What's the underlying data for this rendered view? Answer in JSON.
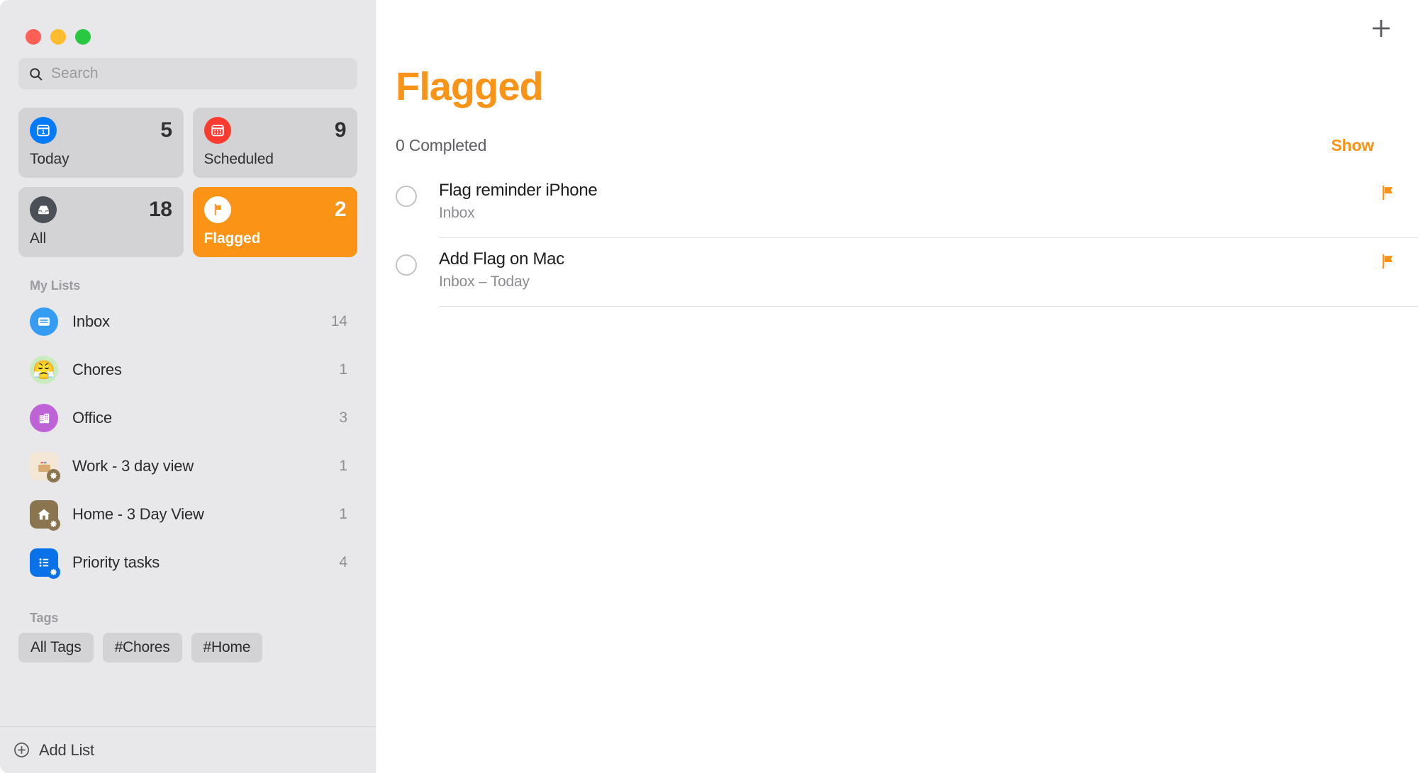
{
  "window": {
    "traffic_lights": [
      "close",
      "minimize",
      "maximize"
    ]
  },
  "sidebar": {
    "search": {
      "placeholder": "Search",
      "value": "",
      "icon": "search-icon"
    },
    "smart_lists": [
      {
        "label": "Today",
        "count": "5",
        "icon": "calendar-day-icon",
        "selected": false
      },
      {
        "label": "Scheduled",
        "count": "9",
        "icon": "calendar-icon",
        "selected": false
      },
      {
        "label": "All",
        "count": "18",
        "icon": "inbox-tray-icon",
        "selected": false
      },
      {
        "label": "Flagged",
        "count": "2",
        "icon": "flag-icon",
        "selected": true
      }
    ],
    "my_lists_header": "My Lists",
    "lists": [
      {
        "label": "Inbox",
        "count": "14",
        "icon": "inbox-icon",
        "smart": false
      },
      {
        "label": "Chores",
        "count": "1",
        "icon": "angry-face-emoji",
        "smart": false
      },
      {
        "label": "Office",
        "count": "3",
        "icon": "office-building-icon",
        "smart": false
      },
      {
        "label": "Work - 3 day view",
        "count": "1",
        "icon": "folder-icon",
        "smart": true
      },
      {
        "label": "Home - 3 Day View",
        "count": "1",
        "icon": "house-icon",
        "smart": true
      },
      {
        "label": "Priority tasks",
        "count": "4",
        "icon": "list-bullet-icon",
        "smart": true
      }
    ],
    "tags_header": "Tags",
    "tags": [
      "All Tags",
      "#Chores",
      "#Home"
    ],
    "add_list_label": "Add List"
  },
  "main": {
    "title": "Flagged",
    "add_button_icon": "plus-icon",
    "completed_text": "0 Completed",
    "show_label": "Show",
    "reminders": [
      {
        "title": "Flag reminder iPhone",
        "subtitle": "Inbox",
        "flagged": true,
        "completed": false
      },
      {
        "title": "Add Flag on Mac",
        "subtitle": "Inbox – Today",
        "flagged": true,
        "completed": false
      }
    ]
  },
  "colors": {
    "accent_orange": "#fb9316",
    "sidebar_bg": "#e8e8eb",
    "card_bg": "#d3d3d6",
    "today_blue": "#007aff",
    "scheduled_red": "#fc3b30",
    "all_gray": "#4a4f58"
  }
}
